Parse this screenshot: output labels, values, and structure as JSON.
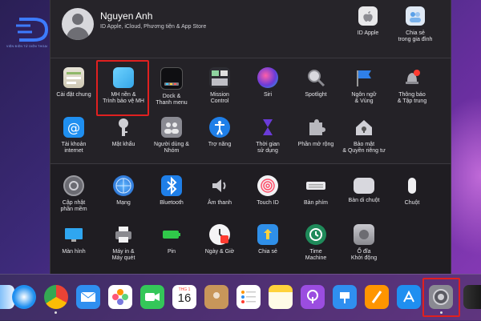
{
  "watermark": {
    "brand": "D",
    "tagline": "VIỆN ĐIỆN TỬ DIỆN THOẠI"
  },
  "account": {
    "name": "Nguyen Anh",
    "subtitle": "ID Apple, iCloud, Phương tiện & App Store",
    "apple_id_label": "ID Apple",
    "family_label": "Chia sẻ\ntrong gia đình"
  },
  "row1": [
    {
      "label": "Cài đặt chung",
      "icon": "general-icon"
    },
    {
      "label": "MH nền &\nTrình bảo vệ MH",
      "icon": "desktop-screensaver-icon"
    },
    {
      "label": "Dock &\nThanh menu",
      "icon": "dock-icon"
    },
    {
      "label": "Mission\nControl",
      "icon": "mission-control-icon"
    },
    {
      "label": "Siri",
      "icon": "siri-icon"
    },
    {
      "label": "Spotlight",
      "icon": "spotlight-icon"
    },
    {
      "label": "Ngôn ngữ\n& Vùng",
      "icon": "language-region-icon"
    },
    {
      "label": "Thông báo\n& Tập trung",
      "icon": "notifications-icon"
    }
  ],
  "row2": [
    {
      "label": "Tài khoản\ninternet",
      "icon": "internet-accounts-icon"
    },
    {
      "label": "Mật khẩu",
      "icon": "passwords-icon"
    },
    {
      "label": "Người dùng &\nNhóm",
      "icon": "users-groups-icon"
    },
    {
      "label": "Trợ năng",
      "icon": "accessibility-icon"
    },
    {
      "label": "Thời gian\nsử dụng",
      "icon": "screen-time-icon"
    },
    {
      "label": "Phần mở rộng",
      "icon": "extensions-icon"
    },
    {
      "label": "Bảo mật\n& Quyền riêng tư",
      "icon": "security-privacy-icon"
    }
  ],
  "row3": [
    {
      "label": "Cập nhật\nphần mềm",
      "icon": "software-update-icon"
    },
    {
      "label": "Mạng",
      "icon": "network-icon"
    },
    {
      "label": "Bluetooth",
      "icon": "bluetooth-icon"
    },
    {
      "label": "Âm thanh",
      "icon": "sound-icon"
    },
    {
      "label": "Touch ID",
      "icon": "touch-id-icon"
    },
    {
      "label": "Bàn phím",
      "icon": "keyboard-icon"
    },
    {
      "label": "Bàn di chuột",
      "icon": "trackpad-icon"
    },
    {
      "label": "Chuột",
      "icon": "mouse-icon"
    }
  ],
  "row4": [
    {
      "label": "Màn hình",
      "icon": "displays-icon"
    },
    {
      "label": "Máy in &\nMáy quét",
      "icon": "printers-scanners-icon"
    },
    {
      "label": "Pin",
      "icon": "battery-icon"
    },
    {
      "label": "Ngày & Giờ",
      "icon": "date-time-icon"
    },
    {
      "label": "Chia sẻ",
      "icon": "sharing-icon"
    },
    {
      "label": "Time\nMachine",
      "icon": "time-machine-icon"
    },
    {
      "label": "Ổ đĩa\nKhởi động",
      "icon": "startup-disk-icon"
    }
  ],
  "dock": {
    "calendar_month": "THG 1",
    "calendar_day": "16",
    "apps": [
      "finder",
      "safari",
      "chrome",
      "mail",
      "photos",
      "facetime",
      "calendar",
      "contacts",
      "reminders",
      "notes",
      "podcasts",
      "keynote",
      "pages",
      "app-store",
      "system-preferences"
    ]
  },
  "highlight_color": "#e02020"
}
